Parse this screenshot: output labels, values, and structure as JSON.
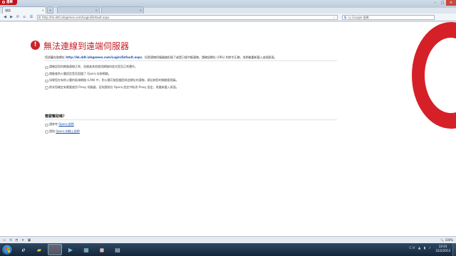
{
  "browser": {
    "menu_label": "選單",
    "tabs": [
      {
        "title": "錯誤",
        "active": true
      },
      {
        "title": "",
        "active": false
      },
      {
        "title": "",
        "active": false
      }
    ],
    "address": "http://hk.ddt.iahgames.com/Login/Default.aspx",
    "search_placeholder": "以 Google 搜尋",
    "accent": "#c41f26"
  },
  "error_page": {
    "title": "無法連線到遠端伺服器",
    "intro_prefix": "您試圖存取網址",
    "intro_url": "http://hk.ddt.iahgames.com/Login/Default.aspx",
    "intro_suffix": "，但是連線伺服器被拒絕了或是已經中斷連線。請確認網址 (URL) 的拼字正確，並稍後重新載入這個頁面。",
    "tips": [
      "請確認您的網路連線正常，並檢查其他使用網路的程式是否正常運作。",
      "請檢查防火牆設定是否阻擋了 Opera 存取網路。",
      "如果您在有防火牆的區域網路 (LAN) 中，防火牆可能阻擋您與此網址的連線，請洽詢您的網路管理員。",
      "除非您確定有需要使用 Proxy 伺服器，否則請前往 Opera 設定中取消 Proxy 設定，再重新載入頁面。"
    ],
    "help_title": "需要幫助嗎？",
    "help_items": [
      {
        "prefix": "請參考",
        "link": "Opera 說明"
      },
      {
        "prefix": "請到",
        "link": "Opera 的線上說明"
      }
    ]
  },
  "statusbar": {
    "zoom": "100%"
  },
  "taskbar": {
    "lang": "CH",
    "time": "22:01",
    "date": "22/2/2013"
  }
}
